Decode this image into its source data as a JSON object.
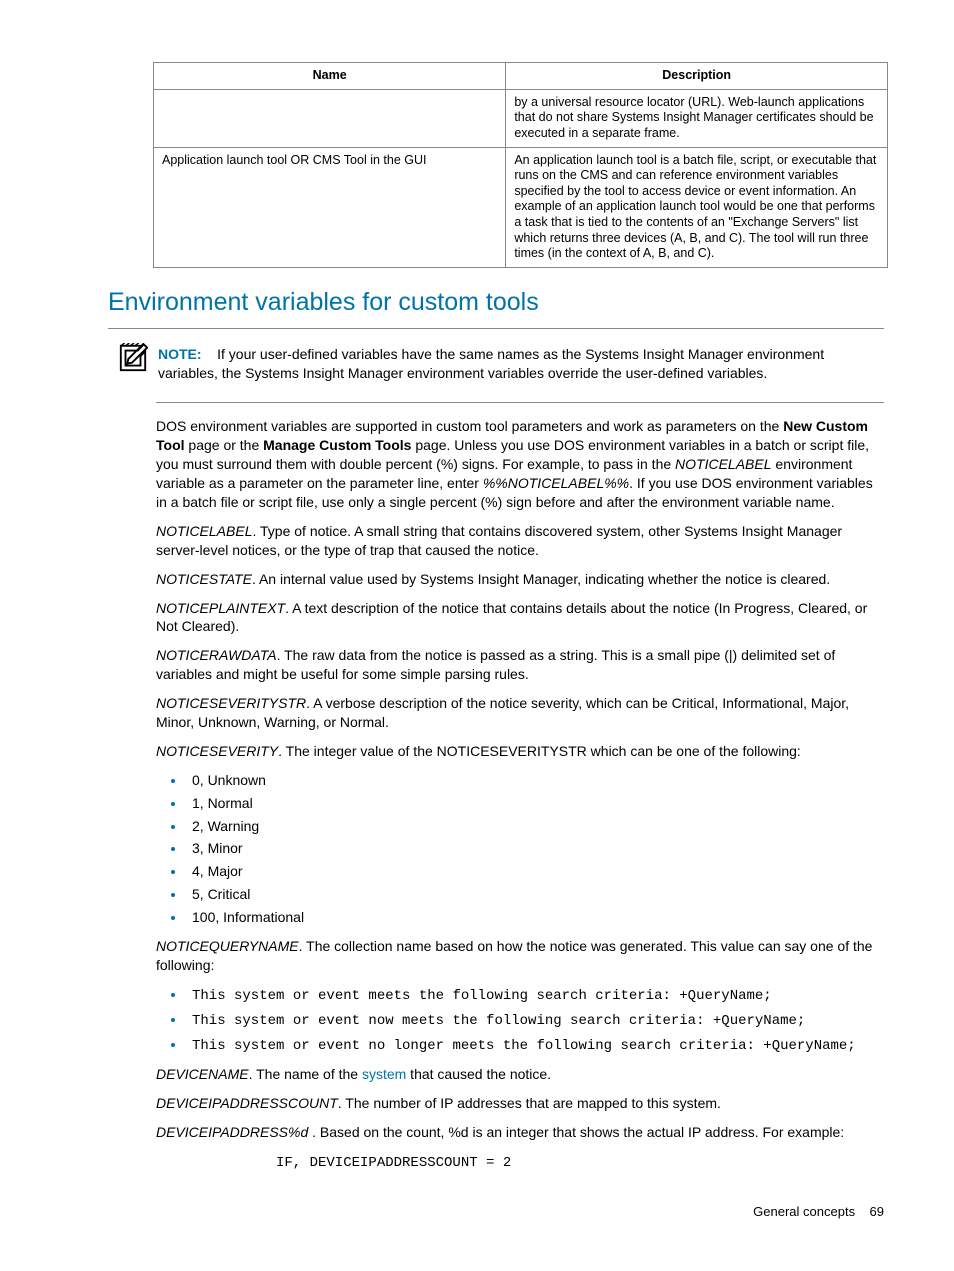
{
  "table": {
    "headers": [
      "Name",
      "Description"
    ],
    "rows": [
      {
        "name": "",
        "desc": "by a universal resource locator (URL). Web-launch applications that do not share Systems Insight Manager certificates should be executed in a separate frame."
      },
      {
        "name": "Application launch tool OR CMS Tool in the GUI",
        "desc": "An application launch tool is a batch file, script, or executable that runs on the CMS and can reference environment variables specified by the tool to access device or event information. An example of an application launch tool would be one that performs a task that is tied to the contents of an \"Exchange Servers\" list which returns three devices (A, B, and C). The tool will run three times (in the context of A, B, and C)."
      }
    ]
  },
  "section_title": "Environment variables for custom tools",
  "note_label": "NOTE:",
  "note_text": "If your user-defined variables have the same names as the Systems Insight Manager environment variables, the Systems Insight Manager environment variables override the user-defined variables.",
  "para1_a": "DOS environment variables are supported in custom tool parameters and work as parameters on the ",
  "para1_b": "New Custom Tool",
  "para1_c": " page or the ",
  "para1_d": "Manage Custom Tools",
  "para1_e": " page. Unless you use DOS environment variables in a batch or script file, you must surround them with double percent (%) signs. For example, to pass in the ",
  "para1_f": "NOTICELABEL",
  "para1_g": " environment variable as a parameter on the parameter line, enter ",
  "para1_h": "%%NOTICELABEL%%",
  "para1_i": ". If you use DOS environment variables in a batch file or script file, use only a single percent (%) sign before and after the environment variable name.",
  "v_noticelabel": "NOTICELABEL",
  "v_noticelabel_desc": ". Type of notice. A small string that contains discovered system, other Systems Insight Manager server-level notices, or the type of trap that caused the notice.",
  "v_noticestate": "NOTICESTATE",
  "v_noticestate_desc": ". An internal value used by Systems Insight Manager, indicating whether the notice is cleared.",
  "v_noticeplaintext": "NOTICEPLAINTEXT",
  "v_noticeplaintext_desc": ". A text description of the notice that contains details about the notice (In Progress, Cleared, or Not Cleared).",
  "v_noticerawdata": "NOTICERAWDATA",
  "v_noticerawdata_desc": ". The raw data from the notice is passed as a string. This is a small pipe (|) delimited set of variables and might be useful for some simple parsing rules.",
  "v_noticeseveritystr": "NOTICESEVERITYSTR",
  "v_noticeseveritystr_desc": ". A verbose description of the notice severity, which can be Critical, Informational, Major, Minor, Unknown, Warning, or Normal.",
  "v_noticeseverity": "NOTICESEVERITY",
  "v_noticeseverity_desc": ". The integer value of the NOTICESEVERITYSTR which can be one of the following:",
  "sev_items": [
    "0, Unknown",
    "1, Normal",
    "2, Warning",
    "3, Minor",
    "4, Major",
    "5, Critical",
    "100, Informational"
  ],
  "v_noticequeryname": "NOTICEQUERYNAME",
  "v_noticequeryname_desc": ". The collection name based on how the notice was generated. This value can say one of the following:",
  "q_items": [
    "This system or event meets the following search criteria: +QueryName;",
    "This system or event now meets the following search criteria: +QueryName;",
    "This system or event no longer meets the following search criteria: +QueryName;"
  ],
  "v_devicename": "DEVICENAME",
  "v_devicename_a": ". The name of the ",
  "v_devicename_b": "system",
  "v_devicename_c": " that caused the notice.",
  "v_deviceipcount": "DEVICEIPADDRESSCOUNT",
  "v_deviceipcount_desc": ". The number of IP addresses that are mapped to this system.",
  "v_deviceipaddr": "DEVICEIPADDRESS%d ",
  "v_deviceipaddr_desc": ". Based on the count, %d is an integer that shows the actual IP address. For example:",
  "code_line": "IF, DEVICEIPADDRESSCOUNT = 2",
  "footer_label": "General concepts",
  "footer_page": "69"
}
